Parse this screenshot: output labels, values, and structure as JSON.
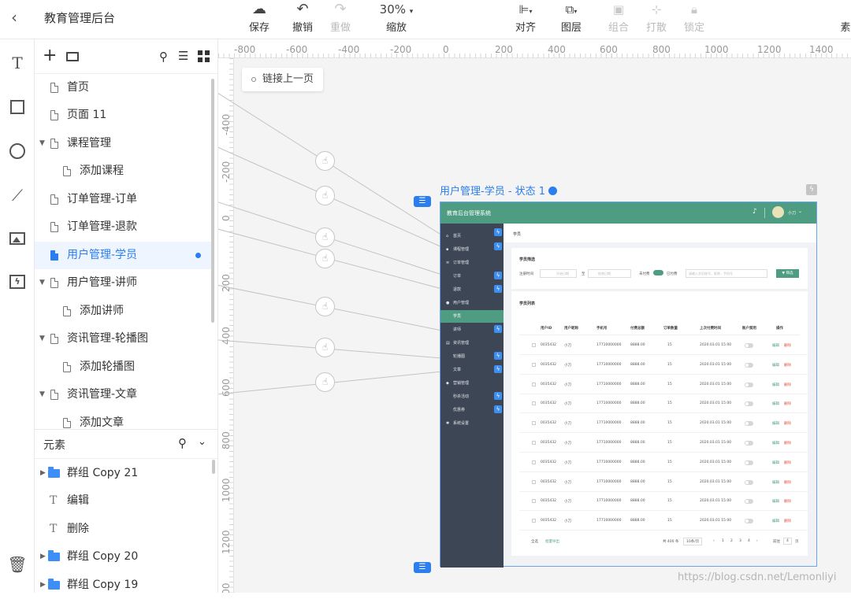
{
  "app": {
    "title": "教育管理后台"
  },
  "toolbar": {
    "save": "保存",
    "undo": "撤销",
    "redo": "重做",
    "zoom_value": "30%",
    "zoom_label": "缩放",
    "align": "对齐",
    "layer": "图层",
    "group": "组合",
    "ungroup": "打散",
    "lock": "锁定",
    "more": "素"
  },
  "pages": {
    "items": [
      {
        "label": "首页"
      },
      {
        "label": "页面 11"
      },
      {
        "label": "课程管理"
      },
      {
        "label": "添加课程"
      },
      {
        "label": "订单管理-订单"
      },
      {
        "label": "订单管理-退款"
      },
      {
        "label": "用户管理-学员"
      },
      {
        "label": "用户管理-讲师"
      },
      {
        "label": "添加讲师"
      },
      {
        "label": "资讯管理-轮播图"
      },
      {
        "label": "添加轮播图"
      },
      {
        "label": "资讯管理-文章"
      },
      {
        "label": "添加文章"
      }
    ]
  },
  "elements": {
    "title": "元素",
    "items": [
      {
        "label": "群组 Copy 21"
      },
      {
        "label": "编辑"
      },
      {
        "label": "删除"
      },
      {
        "label": "群组 Copy 20"
      },
      {
        "label": "群组 Copy 19"
      }
    ]
  },
  "ruler": {
    "top": [
      "-800",
      "-600",
      "-400",
      "-200",
      "0",
      "200",
      "400",
      "600",
      "800",
      "1000",
      "1200",
      "1400"
    ],
    "left": [
      "-400",
      "-200",
      "0",
      "200",
      "400",
      "600",
      "800",
      "1000",
      "1200",
      "1400"
    ]
  },
  "canvas": {
    "link_back": "链接上一页",
    "artboard_title": "用户管理-学员 - 状态 1",
    "watermark": "https://blog.csdn.net/Lemonliyi"
  },
  "mock": {
    "system": "教育后台管理系统",
    "user": "小刀",
    "breadcrumb": "学员",
    "filter_title": "学员筛选",
    "register_time": "注册时间",
    "start_placeholder": "开始日期",
    "to": "至",
    "end_placeholder": "结束日期",
    "unpaid": "未付费",
    "paid": "已付费",
    "search_placeholder": "请输入学员账号，昵称，手机号",
    "filter_btn": "筛选",
    "list_title": "学员列表",
    "menu": [
      "首页",
      "课程管理",
      "订单管理",
      "订单",
      "退款",
      "用户管理",
      "学员",
      "讲师",
      "资讯管理",
      "轮播图",
      "文章",
      "营销管理",
      "秒杀活动",
      "优惠券",
      "系统设置"
    ],
    "cols": [
      "用户ID",
      "用户昵称",
      "手机号",
      "付费总额",
      "订单数量",
      "上次付费时间",
      "账户禁用",
      "操作"
    ],
    "rows": [
      {
        "id": "0035432",
        "nick": "小刀",
        "phone": "17710000000",
        "total": "8888.00",
        "orders": "15",
        "last": "2020.03.01  15:00"
      },
      {
        "id": "0035432",
        "nick": "小刀",
        "phone": "17710000000",
        "total": "8888.00",
        "orders": "15",
        "last": "2020.03.01  15:00"
      },
      {
        "id": "0035432",
        "nick": "小刀",
        "phone": "17710000000",
        "total": "8888.00",
        "orders": "15",
        "last": "2020.03.01  15:00"
      },
      {
        "id": "0035432",
        "nick": "小刀",
        "phone": "17710000000",
        "total": "8888.00",
        "orders": "15",
        "last": "2020.03.01  15:00"
      },
      {
        "id": "0035432",
        "nick": "小刀",
        "phone": "17710000000",
        "total": "8888.00",
        "orders": "15",
        "last": "2020.03.01  15:00"
      },
      {
        "id": "0035432",
        "nick": "小刀",
        "phone": "17710000000",
        "total": "8888.00",
        "orders": "15",
        "last": "2020.03.01  15:00"
      },
      {
        "id": "0035432",
        "nick": "小刀",
        "phone": "17710000000",
        "total": "8888.00",
        "orders": "15",
        "last": "2020.03.01  15:00"
      },
      {
        "id": "0035432",
        "nick": "小刀",
        "phone": "17710000000",
        "total": "8888.00",
        "orders": "15",
        "last": "2020.03.01  15:00"
      },
      {
        "id": "0035432",
        "nick": "小刀",
        "phone": "17710000000",
        "total": "8888.00",
        "orders": "15",
        "last": "2020.03.01  15:00"
      },
      {
        "id": "0035432",
        "nick": "小刀",
        "phone": "17710000000",
        "total": "8888.00",
        "orders": "15",
        "last": "2020.03.01  15:00"
      }
    ],
    "edit": "编辑",
    "delete": "删除",
    "select_all": "全选",
    "export": "批量导出",
    "total": "共 400 条",
    "page_size": "10条/页",
    "pages": [
      "1",
      "2",
      "3",
      "4"
    ],
    "goto": "前往",
    "goto_page": "4",
    "page_unit": "页"
  },
  "colors": {
    "accent": "#2b7ef0",
    "mock_green": "#4e9d83",
    "mock_sidebar": "#3d4654"
  }
}
